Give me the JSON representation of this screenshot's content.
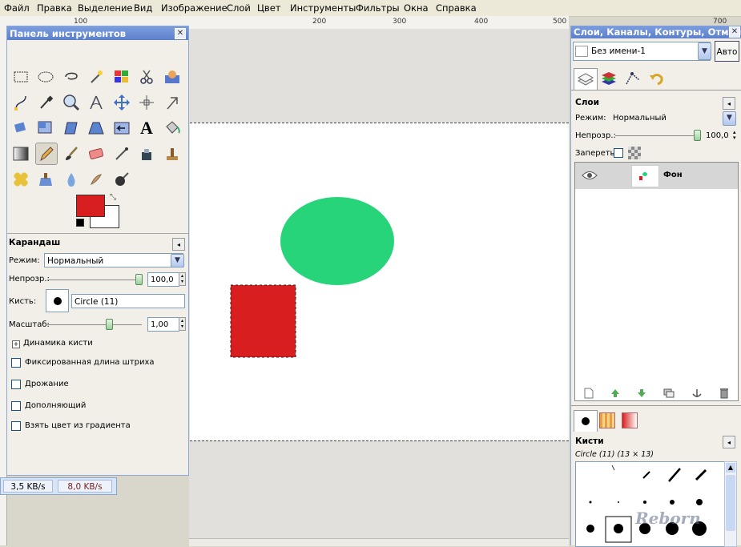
{
  "menubar": {
    "items": [
      "Файл",
      "Правка",
      "Выделение",
      "Вид",
      "Изображение",
      "Слой",
      "Цвет",
      "Инструменты",
      "Фильтры",
      "Окна",
      "Справка"
    ]
  },
  "rulers": {
    "h_ticks": [
      "100",
      "200",
      "300",
      "400",
      "500",
      "700"
    ]
  },
  "toolbox": {
    "title": "Панель инструментов",
    "tools": [
      "rect-select",
      "ellipse-select",
      "free-select",
      "fuzzy-select",
      "by-color-select",
      "scissors",
      "foreground-select",
      "paths",
      "color-picker",
      "zoom",
      "measure",
      "move",
      "align",
      "crop",
      "rotate",
      "scale",
      "shear",
      "perspective",
      "flip",
      "text",
      "bucket-fill",
      "blend",
      "pencil",
      "paintbrush",
      "eraser",
      "airbrush",
      "ink",
      "clone",
      "heal",
      "smudge",
      "dodge-burn",
      "convolve"
    ],
    "colors": {
      "foreground": "#d81e1e",
      "background": "#ffffff"
    },
    "options": {
      "title": "Карандаш",
      "mode_label": "Режим:",
      "mode_value": "Нормальный",
      "opacity_label": "Непрозр.:",
      "opacity_value": "100,0",
      "opacity_fraction": 1.0,
      "brush_label": "Кисть:",
      "brush_value": "Circle (11)",
      "scale_label": "Масштаб:",
      "scale_value": "1,00",
      "dynamics_label": "Динамика кисти",
      "checkboxes": [
        "Фиксированная длина штриха",
        "Дрожание",
        "Дополняющий",
        "Взять цвет из градиента"
      ]
    }
  },
  "speed": {
    "down": "3,5 KB/s",
    "up": "8,0 KB/s"
  },
  "canvas": {
    "background": "#ffffff",
    "shapes": [
      {
        "type": "ellipse",
        "color": "#27d47a"
      },
      {
        "type": "rect",
        "color": "#d81e1e",
        "selected": true
      }
    ]
  },
  "dock": {
    "title": "Слои, Каналы, Контуры, Отмени...",
    "image_select": "Без имени-1",
    "auto_button": "Авто",
    "layers": {
      "title": "Слои",
      "mode_label": "Режим:",
      "mode_value": "Нормальный",
      "opacity_label": "Непрозр.:",
      "opacity_value": "100,0",
      "opacity_fraction": 1.0,
      "lock_label": "Запереть:",
      "items": [
        {
          "name": "Фон",
          "visible": true
        }
      ]
    },
    "brushes": {
      "title": "Кисти",
      "current": "Circle (11) (13 × 13)"
    },
    "watermark": "Reborn"
  }
}
